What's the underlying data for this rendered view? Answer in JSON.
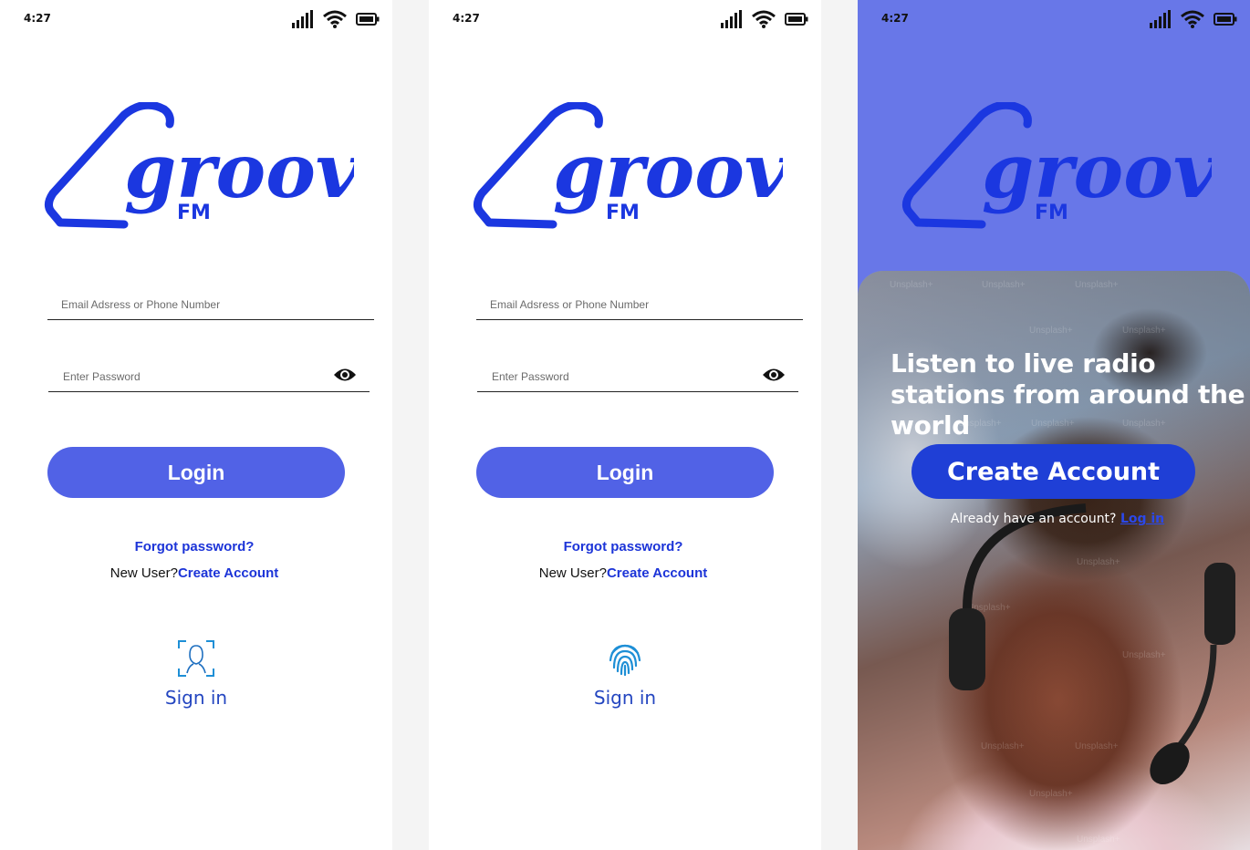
{
  "status_bar": {
    "time": "4:27"
  },
  "logo": {
    "word": "groove",
    "sub": "FM",
    "color": "#1b37e0"
  },
  "login_screen": {
    "email_placeholder": "Email Adsress or Phone Number",
    "password_placeholder": "Enter Password",
    "login_label": "Login",
    "forgot_label": "Forgot password?",
    "new_user_text": "New User?",
    "create_account_link": "Create Account",
    "signin_label": "Sign in",
    "face_icon": "face-id-icon",
    "fingerprint_icon": "fingerprint-icon"
  },
  "welcome_screen": {
    "headline": "Listen to live radio stations from around the world",
    "create_account_label": "Create Account",
    "already_text": "Already have an account?",
    "login_link": "Log in",
    "watermark": "Unsplash+"
  },
  "colors": {
    "accent": "#5162e6",
    "link": "#1c34d8",
    "hero_bg": "#6877e8",
    "button_dark": "#1f3fd6"
  }
}
